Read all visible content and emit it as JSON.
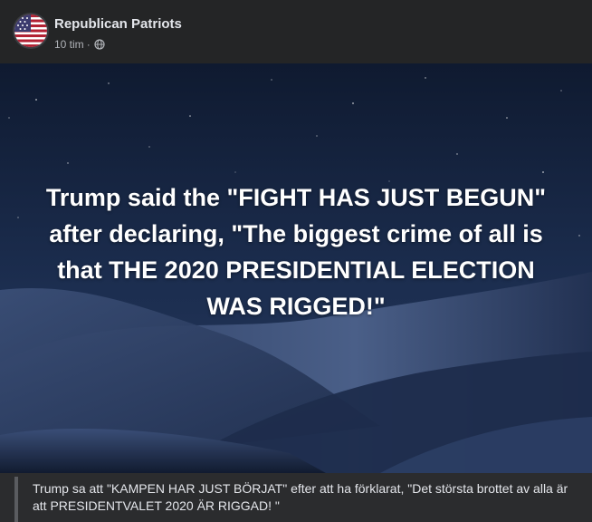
{
  "post": {
    "page_name": "Republican Patriots",
    "timestamp": "10 tim",
    "separator": "·",
    "privacy_icon": "globe-icon",
    "avatar_icon": "us-flag-icon",
    "image": {
      "headline": "Trump said the \"FIGHT HAS JUST BEGUN\" after declaring, \"The biggest crime of all is that THE 2020 PRESIDENTIAL ELECTION WAS RIGGED!\""
    },
    "caption": "Trump sa att \"KAMPEN HAR JUST BÖRJAT\" efter att ha förklarat, \"Det största brottet av alla är att PRESIDENTVALET 2020 ÄR RIGGAD! \""
  },
  "colors": {
    "background": "#242526",
    "text_primary": "#e4e6eb",
    "text_secondary": "#b0b3b8",
    "night_sky": "#1b2a4a"
  }
}
